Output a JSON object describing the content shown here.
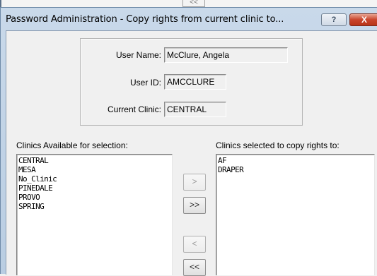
{
  "background_window": {
    "button_label": "<<"
  },
  "dialog": {
    "title": "Password Administration - Copy rights from current clinic to...",
    "help_glyph": "?",
    "close_glyph": "X"
  },
  "user_info": {
    "user_name_label": "User Name:",
    "user_name_value": "McClure, Angela",
    "user_id_label": "User ID:",
    "user_id_value": "AMCCLURE",
    "current_clinic_label": "Current Clinic:",
    "current_clinic_value": "CENTRAL"
  },
  "available": {
    "caption": "Clinics Available for selection:",
    "items": [
      "CENTRAL",
      "MESA",
      "No_Clinic",
      "PINEDALE",
      "PROVO",
      "SPRING"
    ]
  },
  "selected": {
    "caption": "Clinics selected to copy rights to:",
    "items": [
      "AF",
      "DRAPER"
    ]
  },
  "buttons": {
    "add_one": ">",
    "add_all": ">>",
    "remove_one": "<",
    "remove_all": "<<"
  },
  "colors": {
    "close_button": "#c9442b",
    "titlebar": "#c9d9ea"
  },
  "icons": {
    "help": "help-icon",
    "close": "close-icon"
  }
}
